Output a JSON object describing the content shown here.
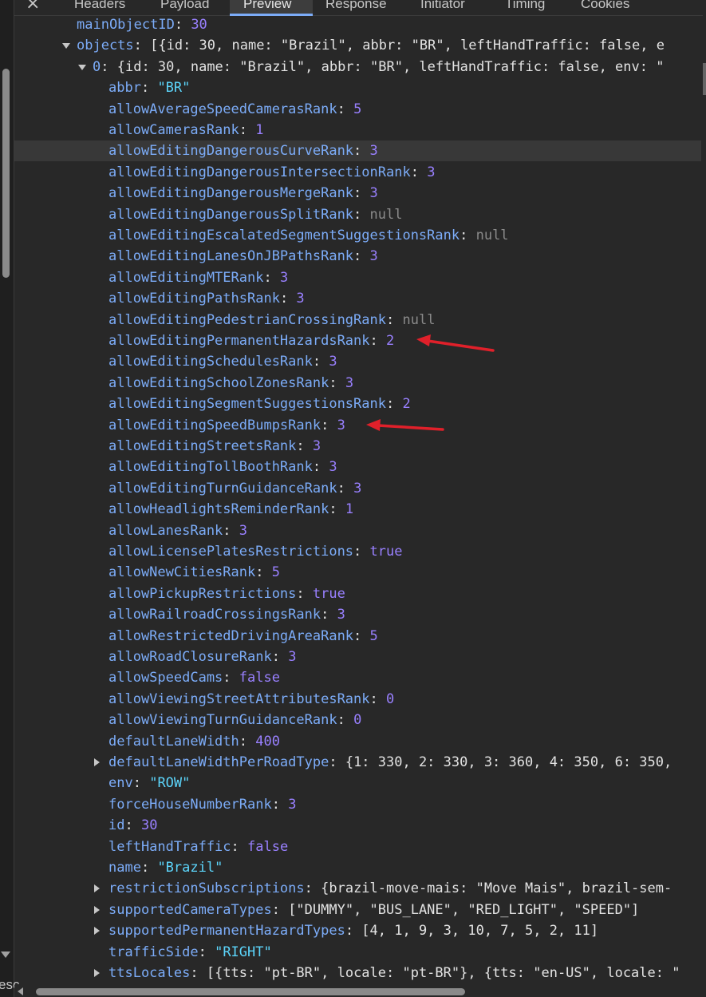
{
  "devtools": {
    "close_label": "×",
    "tabs": [
      {
        "label": "Headers"
      },
      {
        "label": "Payload"
      },
      {
        "label": "Preview",
        "active": true
      },
      {
        "label": "Response"
      },
      {
        "label": "Initiator"
      },
      {
        "label": "Timing"
      },
      {
        "label": "Cookies"
      }
    ],
    "left_fragment": "esc",
    "accent_color": "#7cacf8"
  },
  "preview": {
    "rows": [
      {
        "key": "mainObjectID",
        "value": "30",
        "type": "num",
        "indent": 0
      },
      {
        "key": "objects",
        "value": "[{id: 30, name: \"Brazil\", abbr: \"BR\", leftHandTraffic: false, e",
        "type": "summary",
        "indent": 0,
        "toggle": "down"
      },
      {
        "key": "0",
        "value": "{id: 30, name: \"Brazil\", abbr: \"BR\", leftHandTraffic: false, env: \"",
        "type": "summary",
        "indent": 1,
        "toggle": "down"
      },
      {
        "key": "abbr",
        "value": "\"BR\"",
        "type": "str",
        "indent": 2
      },
      {
        "key": "allowAverageSpeedCamerasRank",
        "value": "5",
        "type": "num",
        "indent": 2
      },
      {
        "key": "allowCamerasRank",
        "value": "1",
        "type": "num",
        "indent": 2
      },
      {
        "key": "allowEditingDangerousCurveRank",
        "value": "3",
        "type": "num",
        "indent": 2,
        "highlight": true
      },
      {
        "key": "allowEditingDangerousIntersectionRank",
        "value": "3",
        "type": "num",
        "indent": 2
      },
      {
        "key": "allowEditingDangerousMergeRank",
        "value": "3",
        "type": "num",
        "indent": 2
      },
      {
        "key": "allowEditingDangerousSplitRank",
        "value": "null",
        "type": "null",
        "indent": 2
      },
      {
        "key": "allowEditingEscalatedSegmentSuggestionsRank",
        "value": "null",
        "type": "null",
        "indent": 2
      },
      {
        "key": "allowEditingLanesOnJBPathsRank",
        "value": "3",
        "type": "num",
        "indent": 2
      },
      {
        "key": "allowEditingMTERank",
        "value": "3",
        "type": "num",
        "indent": 2
      },
      {
        "key": "allowEditingPathsRank",
        "value": "3",
        "type": "num",
        "indent": 2
      },
      {
        "key": "allowEditingPedestrianCrossingRank",
        "value": "null",
        "type": "null",
        "indent": 2
      },
      {
        "key": "allowEditingPermanentHazardsRank",
        "value": "2",
        "type": "num",
        "indent": 2
      },
      {
        "key": "allowEditingSchedulesRank",
        "value": "3",
        "type": "num",
        "indent": 2
      },
      {
        "key": "allowEditingSchoolZonesRank",
        "value": "3",
        "type": "num",
        "indent": 2
      },
      {
        "key": "allowEditingSegmentSuggestionsRank",
        "value": "2",
        "type": "num",
        "indent": 2
      },
      {
        "key": "allowEditingSpeedBumpsRank",
        "value": "3",
        "type": "num",
        "indent": 2
      },
      {
        "key": "allowEditingStreetsRank",
        "value": "3",
        "type": "num",
        "indent": 2
      },
      {
        "key": "allowEditingTollBoothRank",
        "value": "3",
        "type": "num",
        "indent": 2
      },
      {
        "key": "allowEditingTurnGuidanceRank",
        "value": "3",
        "type": "num",
        "indent": 2
      },
      {
        "key": "allowHeadlightsReminderRank",
        "value": "1",
        "type": "num",
        "indent": 2
      },
      {
        "key": "allowLanesRank",
        "value": "3",
        "type": "num",
        "indent": 2
      },
      {
        "key": "allowLicensePlatesRestrictions",
        "value": "true",
        "type": "num",
        "indent": 2
      },
      {
        "key": "allowNewCitiesRank",
        "value": "5",
        "type": "num",
        "indent": 2
      },
      {
        "key": "allowPickupRestrictions",
        "value": "true",
        "type": "num",
        "indent": 2
      },
      {
        "key": "allowRailroadCrossingsRank",
        "value": "3",
        "type": "num",
        "indent": 2
      },
      {
        "key": "allowRestrictedDrivingAreaRank",
        "value": "5",
        "type": "num",
        "indent": 2
      },
      {
        "key": "allowRoadClosureRank",
        "value": "3",
        "type": "num",
        "indent": 2
      },
      {
        "key": "allowSpeedCams",
        "value": "false",
        "type": "num",
        "indent": 2
      },
      {
        "key": "allowViewingStreetAttributesRank",
        "value": "0",
        "type": "num",
        "indent": 2
      },
      {
        "key": "allowViewingTurnGuidanceRank",
        "value": "0",
        "type": "num",
        "indent": 2
      },
      {
        "key": "defaultLaneWidth",
        "value": "400",
        "type": "num",
        "indent": 2
      },
      {
        "key": "defaultLaneWidthPerRoadType",
        "value": "{1: 330, 2: 330, 3: 360, 4: 350, 6: 350,",
        "type": "summary",
        "indent": 2,
        "toggle": "right"
      },
      {
        "key": "env",
        "value": "\"ROW\"",
        "type": "str",
        "indent": 2
      },
      {
        "key": "forceHouseNumberRank",
        "value": "3",
        "type": "num",
        "indent": 2
      },
      {
        "key": "id",
        "value": "30",
        "type": "num",
        "indent": 2
      },
      {
        "key": "leftHandTraffic",
        "value": "false",
        "type": "num",
        "indent": 2
      },
      {
        "key": "name",
        "value": "\"Brazil\"",
        "type": "str",
        "indent": 2
      },
      {
        "key": "restrictionSubscriptions",
        "value": "{brazil-move-mais: \"Move Mais\", brazil-sem-",
        "type": "summary",
        "indent": 2,
        "toggle": "right"
      },
      {
        "key": "supportedCameraTypes",
        "value": "[\"DUMMY\", \"BUS_LANE\", \"RED_LIGHT\", \"SPEED\"]",
        "type": "summary",
        "indent": 2,
        "toggle": "right"
      },
      {
        "key": "supportedPermanentHazardTypes",
        "value": "[4, 1, 9, 3, 10, 7, 5, 2, 11]",
        "type": "summary",
        "indent": 2,
        "toggle": "right"
      },
      {
        "key": "trafficSide",
        "value": "\"RIGHT\"",
        "type": "str",
        "indent": 2
      },
      {
        "key": "ttsLocales",
        "value": "[{tts: \"pt-BR\", locale: \"pt-BR\"}, {tts: \"en-US\", locale: \"",
        "type": "summary",
        "indent": 2,
        "toggle": "right"
      }
    ]
  },
  "annotations": {
    "arrow_color": "#e0202a"
  }
}
